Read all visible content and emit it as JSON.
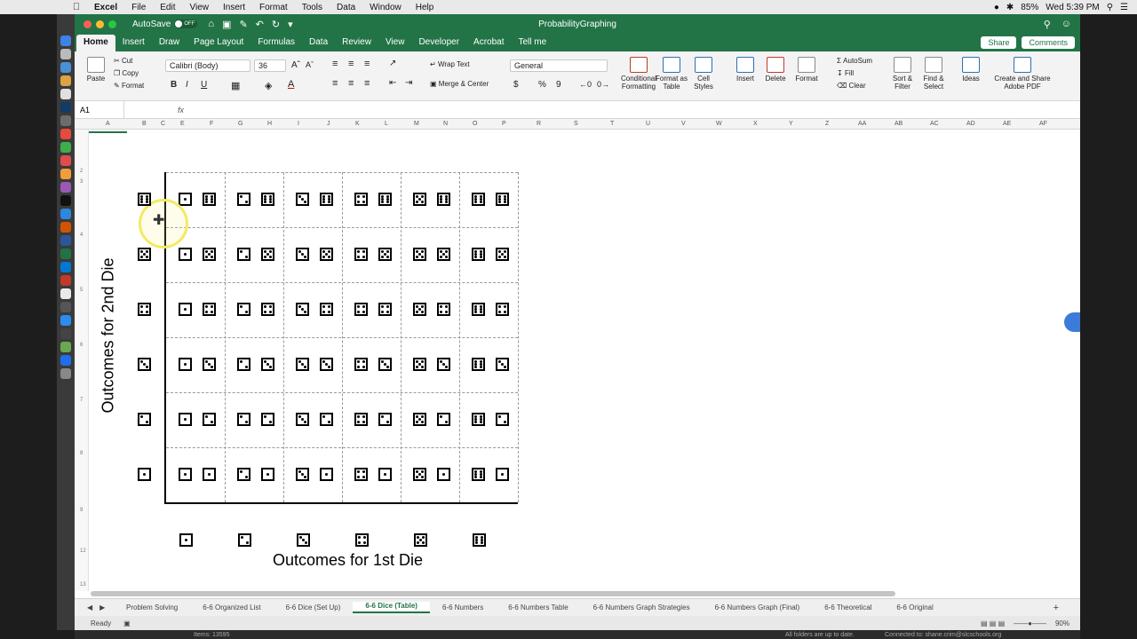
{
  "menubar": {
    "app": "Excel",
    "items": [
      "File",
      "Edit",
      "View",
      "Insert",
      "Format",
      "Tools",
      "Data",
      "Window",
      "Help"
    ],
    "battery": "85%",
    "clock": "Wed 5:39 PM"
  },
  "titlebar": {
    "autosave_label": "AutoSave",
    "autosave_state": "OFF",
    "doc_title": "ProbabilityGraphing"
  },
  "ribbon_tabs": [
    "Home",
    "Insert",
    "Draw",
    "Page Layout",
    "Formulas",
    "Data",
    "Review",
    "View",
    "Developer",
    "Acrobat",
    "Tell me"
  ],
  "share_label": "Share",
  "comments_label": "Comments",
  "ribbon": {
    "paste": "Paste",
    "cut": "Cut",
    "copy": "Copy",
    "format_painter": "Format",
    "font_name": "Calibri (Body)",
    "font_size": "36",
    "bold": "B",
    "italic": "I",
    "underline": "U",
    "wrap_text": "Wrap Text",
    "merge_center": "Merge & Center",
    "number_format": "General",
    "percent": "%",
    "comma": "9",
    "conditional_formatting": "Conditional Formatting",
    "format_as_table": "Format as Table",
    "cell_styles": "Cell Styles",
    "insert": "Insert",
    "delete": "Delete",
    "format": "Format",
    "autosum": "AutoSum",
    "fill": "Fill",
    "clear": "Clear",
    "sort_filter": "Sort & Filter",
    "find_select": "Find & Select",
    "ideas": "Ideas",
    "create_share_pdf": "Create and Share Adobe PDF"
  },
  "formula_bar": {
    "name_box": "A1",
    "fx": "fx"
  },
  "columns": [
    "A",
    "B",
    "C",
    "E",
    "F",
    "G",
    "H",
    "I",
    "J",
    "K",
    "L",
    "M",
    "N",
    "O",
    "P",
    "R",
    "S",
    "T",
    "U",
    "V",
    "W",
    "X",
    "Y",
    "Z",
    "AA",
    "AB",
    "AC",
    "AD",
    "AE",
    "AF"
  ],
  "rows": [
    "2",
    "3",
    "4",
    "5",
    "6",
    "7",
    "8",
    "9",
    "12",
    "13"
  ],
  "table": {
    "y_axis_label": "Outcomes for 2nd Die",
    "x_axis_label": "Outcomes for 1st Die",
    "row_header_faces": [
      6,
      5,
      4,
      3,
      2,
      1
    ],
    "column_header_faces": [
      1,
      2,
      3,
      4,
      5,
      6
    ]
  },
  "sheet_tabs": [
    "Problem Solving",
    "6-6 Organized List",
    "6-6 Dice (Set Up)",
    "6-6 Dice (Table)",
    "6-6 Numbers",
    "6-6 Numbers Table",
    "6-6 Numbers Graph Strategies",
    "6-6 Numbers Graph (Final)",
    "6-6 Theoretical",
    "6-6 Original"
  ],
  "active_sheet": "6-6 Dice (Table)",
  "status": {
    "ready": "Ready",
    "zoom": "90%"
  },
  "bottom_strip": {
    "items": "Items: 13595",
    "sync": "All folders are up to date.",
    "connected": "Connected to: shane.crim@slcschools.org"
  },
  "colors": {
    "excel_green": "#227447",
    "grid_dash": "#9a9a9a"
  }
}
